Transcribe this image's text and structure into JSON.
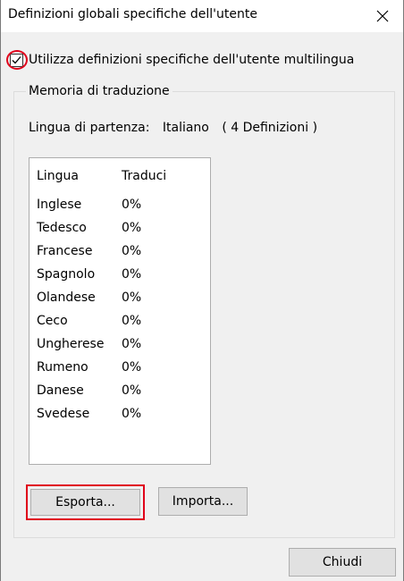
{
  "window": {
    "title": "Definizioni globali specifiche dell'utente",
    "close_glyph": "✕"
  },
  "checkbox": {
    "checked": true,
    "label": "Utilizza definizioni specifiche dell'utente multilingua"
  },
  "group": {
    "title": "Memoria di traduzione",
    "source_label": "Lingua di partenza:",
    "source_value": "Italiano",
    "definitions_count": "( 4 Definizioni )"
  },
  "table": {
    "headers": [
      "Lingua",
      "Traduci"
    ],
    "rows": [
      [
        "Inglese",
        "0%"
      ],
      [
        "Tedesco",
        "0%"
      ],
      [
        "Francese",
        "0%"
      ],
      [
        "Spagnolo",
        "0%"
      ],
      [
        "Olandese",
        "0%"
      ],
      [
        "Ceco",
        "0%"
      ],
      [
        "Ungherese",
        "0%"
      ],
      [
        "Rumeno",
        "0%"
      ],
      [
        "Danese",
        "0%"
      ],
      [
        "Svedese",
        "0%"
      ]
    ]
  },
  "buttons": {
    "export": "Esporta...",
    "import": "Importa...",
    "close": "Chiudi"
  },
  "colors": {
    "highlight": "#e0001a"
  }
}
